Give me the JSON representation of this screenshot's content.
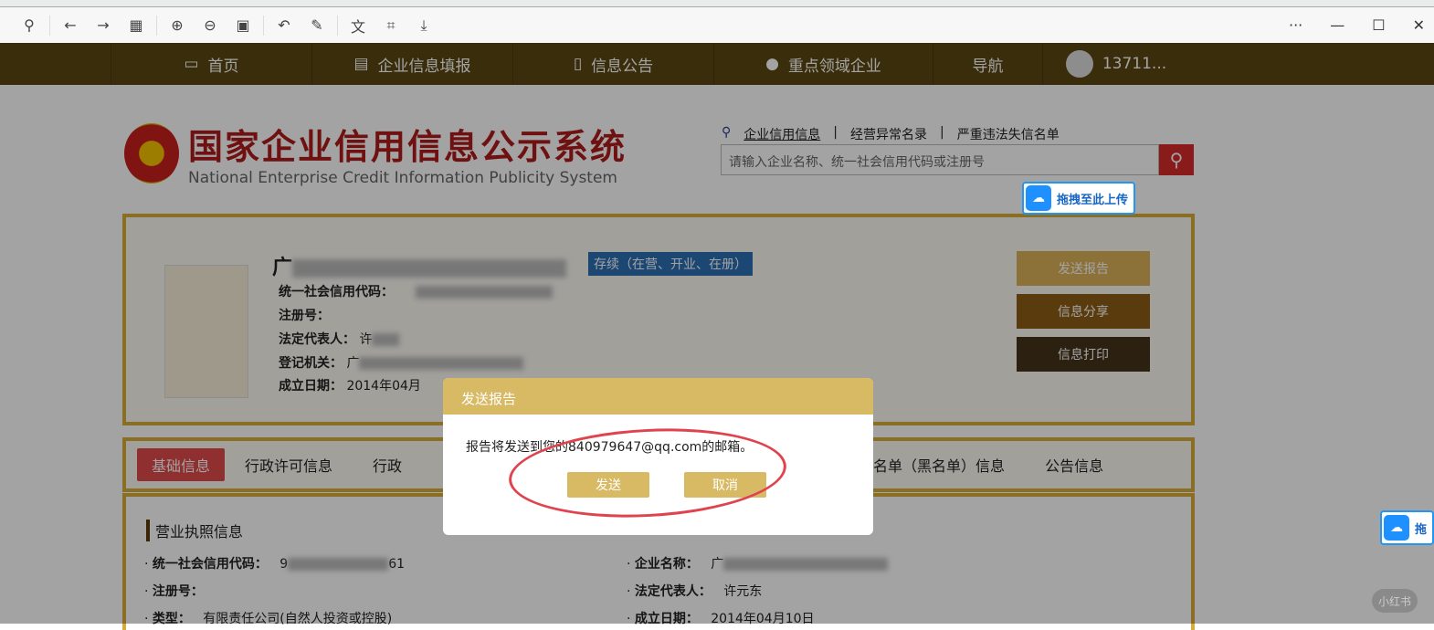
{
  "toolbar": {
    "icons": [
      "pin-icon",
      "back-icon",
      "forward-icon",
      "grid-icon",
      "zoom-in-icon",
      "zoom-out-icon",
      "fit-icon",
      "rotate-icon",
      "edit-icon",
      "translate-icon",
      "ocr-icon",
      "download-icon"
    ],
    "window": {
      "more": "···",
      "minimize": "—",
      "maximize": "☐",
      "close": "✕"
    }
  },
  "nav": {
    "items": [
      "首页",
      "企业信息填报",
      "信息公告",
      "重点领域企业",
      "导航"
    ],
    "user": "13711..."
  },
  "header": {
    "title_cn": "国家企业信用信息公示系统",
    "title_en": "National Enterprise Credit Information Publicity System",
    "links": [
      "企业信用信息",
      "经营异常名录",
      "严重违法失信名单"
    ],
    "search_placeholder": "请输入企业名称、统一社会信用代码或注册号"
  },
  "upload": {
    "label": "拖拽至此上传",
    "short": "拖"
  },
  "company": {
    "name_prefix": "广",
    "status": "存续（在营、开业、在册）",
    "fields": [
      {
        "label": "统一社会信用代码：",
        "value": ""
      },
      {
        "label": "注册号：",
        "value": ""
      },
      {
        "label": "法定代表人：",
        "value": "许"
      },
      {
        "label": "登记机关：",
        "value": "广"
      },
      {
        "label": "成立日期：",
        "value": "2014年04月"
      }
    ],
    "buttons": [
      "发送报告",
      "信息分享",
      "信息打印"
    ]
  },
  "tabs": [
    "基础信息",
    "行政许可信息",
    "行政",
    "失信名单（黑名单）信息",
    "公告信息"
  ],
  "detail": {
    "section": "营业执照信息",
    "left": [
      {
        "label": "统一社会信用代码：",
        "value": "9",
        "suffix": "61"
      },
      {
        "label": "注册号：",
        "value": ""
      },
      {
        "label": "类型：",
        "value": "有限责任公司(自然人投资或控股)"
      }
    ],
    "right": [
      {
        "label": "企业名称：",
        "value": "广"
      },
      {
        "label": "法定代表人：",
        "value": "许元东"
      },
      {
        "label": "成立日期：",
        "value": "2014年04月10日"
      }
    ]
  },
  "dialog": {
    "title": "发送报告",
    "message": "报告将发送到您的840979647@qq.com的邮箱。",
    "send": "发送",
    "cancel": "取消"
  },
  "watermark": "小红书"
}
